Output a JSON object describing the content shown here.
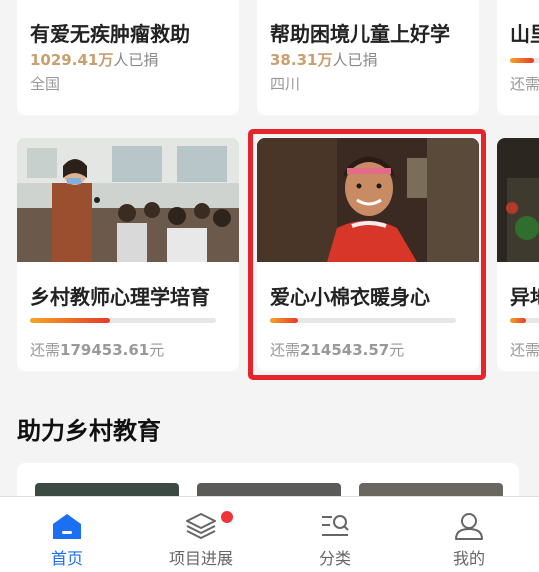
{
  "top_cards": [
    {
      "title": "有爱无疾肿瘤救助",
      "amount": "1029.41万",
      "amount_suffix": "人已捐",
      "region": "全国"
    },
    {
      "title": "帮助困境儿童上好学",
      "amount": "38.31万",
      "amount_suffix": "人已捐",
      "region": "四川"
    },
    {
      "title": "山里",
      "region": "还需"
    }
  ],
  "project_cards": [
    {
      "title": "乡村教师心理学培育",
      "remain_prefix": "还需",
      "remain_amount": "179453.61",
      "remain_suffix": "元",
      "progress": 0.43
    },
    {
      "title": "爱心小棉衣暖身心",
      "remain_prefix": "还需",
      "remain_amount": "214543.57",
      "remain_suffix": "元",
      "progress": 0.15
    },
    {
      "title": "异地",
      "remain_prefix": "还需"
    }
  ],
  "section": {
    "title": "助力乡村教育"
  },
  "tabbar": {
    "items": [
      {
        "label": "首页",
        "icon": "home-icon",
        "active": true
      },
      {
        "label": "项目进展",
        "icon": "layers-icon",
        "badge": true
      },
      {
        "label": "分类",
        "icon": "category-search-icon"
      },
      {
        "label": "我的",
        "icon": "user-icon"
      }
    ]
  },
  "colors": {
    "accent": "#1b6ff2",
    "highlight": "#e8242b",
    "amount": "#c8a070",
    "badge": "#f0323a"
  }
}
